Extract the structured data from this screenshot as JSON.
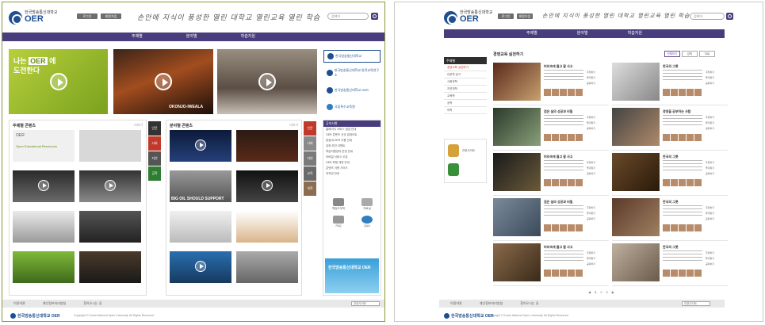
{
  "header": {
    "university": "한국방송통신대학교",
    "logo_text": "OER",
    "btn1": "로그인",
    "btn2": "회원가입",
    "slogan": "손안에 지식이 풍성한 열린 대학교 열린교육 열린 학습",
    "search_placeholder": "검색어"
  },
  "nav": [
    "주제별",
    "분야별",
    "학습지원"
  ],
  "left": {
    "banner_text_line1": "나는",
    "banner_oer": "OER",
    "banner_text_line1b": "에",
    "banner_text_line2": "도전한다",
    "banner2_caption": "OKONJO-IWEALA",
    "partners": [
      "한국방송통신대학교",
      "한국방송통신대학교 원격교육연구소",
      "한국방송통신대학교 OER",
      "국립특수교육원"
    ],
    "section1_title": "주제별 콘텐츠",
    "section1_more": "더보기",
    "oer_card_text": "OER",
    "oer_card_sub": "Open Educational Resources",
    "section2_title": "분야별 콘텐츠",
    "section2_more": "더보기",
    "banner_cap2": "BIG OIL SHOULD SUPPORT",
    "tabs_left": [
      "인문",
      "사회",
      "자연",
      "공학"
    ],
    "tabs_right": [
      "인문",
      "사회",
      "자연",
      "교육",
      "의학"
    ],
    "notice_title": "공지사항",
    "notices": [
      "홈페이지 서비스 점검 안내",
      "OER 콘텐츠 신규 업데이트",
      "방송대 OER 이용 안내",
      "강좌 추천 이벤트",
      "학습지원센터 운영 안내",
      "모바일 서비스 오픈",
      "OER 포털 개편 안내",
      "콘텐츠 이용 가이드",
      "저작권 안내"
    ],
    "icons": [
      "학습도우미",
      "자료실",
      "FAQ",
      "Q&A"
    ],
    "ad_text": "한국방송통신대학교 OER",
    "footer_links": [
      "이용약관",
      "개인정보처리방침",
      "찾아오시는 길"
    ],
    "footer_select": "관련사이트",
    "footer_logo": "한국방송통신대학교 OER",
    "footer_copy": "Copyright © Korea National Open University. All Rights Reserved."
  },
  "right": {
    "sidebar_title": "주제별",
    "sidebar_items": [
      "경영교육 실천하기",
      "인문학 읽기",
      "사회과학",
      "자연과학",
      "교육학",
      "공학",
      "의학"
    ],
    "page_title": "경영교육 실천하기",
    "tabs": [
      "전체보기",
      "강의",
      "자료"
    ],
    "cards": [
      {
        "title": "머리속에 들고 잘 사고",
        "acts": [
          "추천하기",
          "즐겨찾기",
          "공유하기"
        ]
      },
      {
        "title": "한국의 그릇",
        "acts": [
          "추천하기",
          "즐겨찾기",
          "공유하기"
        ]
      },
      {
        "title": "검은 실의 성공과 비밀",
        "acts": [
          "추천하기",
          "즐겨찾기",
          "공유하기"
        ]
      },
      {
        "title": "경영을 공부하는 사람",
        "acts": [
          "추천하기",
          "즐겨찾기",
          "공유하기"
        ]
      },
      {
        "title": "머리속에 들고 잘 사고",
        "acts": [
          "추천하기",
          "즐겨찾기",
          "공유하기"
        ]
      },
      {
        "title": "한국의 그릇",
        "acts": [
          "추천하기",
          "즐겨찾기",
          "공유하기"
        ]
      },
      {
        "title": "검은 실의 성공과 비밀",
        "acts": [
          "추천하기",
          "즐겨찾기",
          "공유하기"
        ]
      },
      {
        "title": "한국의 그릇",
        "acts": [
          "추천하기",
          "즐겨찾기",
          "공유하기"
        ]
      },
      {
        "title": "머리속에 들고 잘 사고",
        "acts": [
          "추천하기",
          "즐겨찾기",
          "공유하기"
        ]
      },
      {
        "title": "한국의 그릇",
        "acts": [
          "추천하기",
          "즐겨찾기",
          "공유하기"
        ]
      }
    ],
    "banner_text": "관련사이트",
    "pager": [
      "◀",
      "1",
      "2",
      "3",
      "▶"
    ],
    "footer_links": [
      "이용약관",
      "개인정보처리방침",
      "찾아오시는 길"
    ],
    "footer_select": "관련사이트",
    "footer_logo": "한국방송통신대학교 OER",
    "footer_copy": "Copyright © Korea National Open University. All Rights Reserved."
  },
  "colors": {
    "nav": "#4a3d7e",
    "brand": "#1e4f91",
    "accent": "#c0392b"
  }
}
